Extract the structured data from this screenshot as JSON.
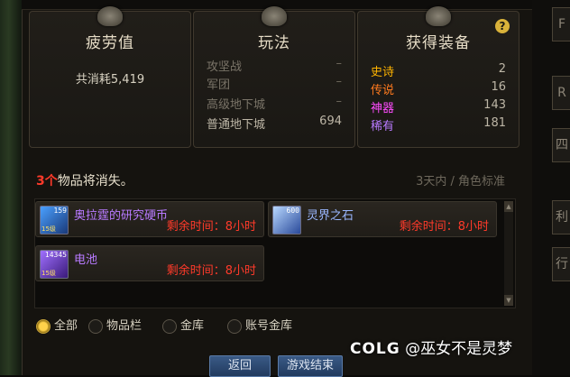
{
  "panels": {
    "fatigue": {
      "title": "疲劳值",
      "total": "共消耗5,419"
    },
    "gameplay": {
      "title": "玩法",
      "rows": [
        {
          "label": "攻坚战",
          "value": "–"
        },
        {
          "label": "军团",
          "value": "–"
        },
        {
          "label": "高级地下城",
          "value": "–"
        },
        {
          "label": "普通地下城",
          "value": "694"
        }
      ]
    },
    "gear": {
      "title": "获得装备",
      "help": "?",
      "rows": [
        {
          "label": "史诗",
          "value": "2",
          "color": "#ffb400"
        },
        {
          "label": "传说",
          "value": "16",
          "color": "#ff7a1e"
        },
        {
          "label": "神器",
          "value": "143",
          "color": "#ff4cff"
        },
        {
          "label": "稀有",
          "value": "181",
          "color": "#b87aff"
        }
      ]
    }
  },
  "vanish": {
    "count": "3个",
    "suffix": "物品将消失。",
    "hint": "3天内 / 角色标准",
    "items": [
      {
        "name": "奥拉霆的研究硬币",
        "remain": "剩余时间：8小时",
        "qty": "159",
        "lvl": "15级"
      },
      {
        "name": "灵界之石",
        "remain": "剩余时间：8小时",
        "qty": "600",
        "lvl": ""
      },
      {
        "name": "电池",
        "remain": "剩余时间：8小时",
        "qty": "14345",
        "lvl": "15级"
      }
    ]
  },
  "filters": [
    {
      "label": "全部",
      "selected": true
    },
    {
      "label": "物品栏",
      "selected": false
    },
    {
      "label": "金库",
      "selected": false
    },
    {
      "label": "账号金库",
      "selected": false
    }
  ],
  "buttons": {
    "back": "返回",
    "end": "游戏结束"
  },
  "side_tabs": [
    "F",
    "R",
    "四",
    "利",
    "行"
  ],
  "watermark": {
    "logo": "COLG",
    "text": "@巫女不是灵梦"
  }
}
